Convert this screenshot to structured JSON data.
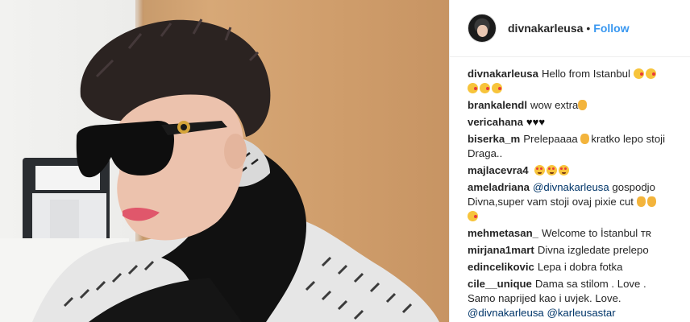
{
  "header": {
    "username": "divnakarleusa",
    "separator": "•",
    "follow_label": "Follow"
  },
  "icons": {
    "avatar": "profile-avatar",
    "kiss": "kissing-face-emoji",
    "heart_eyes": "heart-eyes-emoji",
    "ok_hand": "ok-hand-emoji",
    "thumbs_up": "thumbs-up-emoji",
    "black_heart": "black-heart-emoji"
  },
  "colors": {
    "accent": "#3897f0",
    "mention": "#003569",
    "text": "#262626"
  },
  "comments": [
    {
      "user": "divnakarleusa",
      "text": "Hello from Istanbul"
    },
    {
      "user": "brankalendl",
      "text": "wow extra"
    },
    {
      "user": "vericahana",
      "hearts": "♥♥♥"
    },
    {
      "user": "biserka_m",
      "text_a": "Prelepaaaa",
      "text_b": "kratko lepo stoji Draga.."
    },
    {
      "user": "majlacevra4"
    },
    {
      "user": "ameladriana",
      "mention": "@divnakarleusa",
      "text_a": " gospodjo Divna,super vam stoji ovaj pixie cut"
    },
    {
      "user": "mehmetasan_",
      "text": "Welcome to İstanbul ᴛʀ"
    },
    {
      "user": "mirjana1mart",
      "text": "Divna izgledate prelepo"
    },
    {
      "user": "edincelikovic",
      "text": "Lepa i dobra fotka"
    },
    {
      "user": "cile__unique",
      "text": "Dama sa stilom . Love . Samo naprijed kao i uvjek. Love.",
      "mention_a": "@divnakarleusa",
      "mention_b": "@karleusastar"
    }
  ]
}
